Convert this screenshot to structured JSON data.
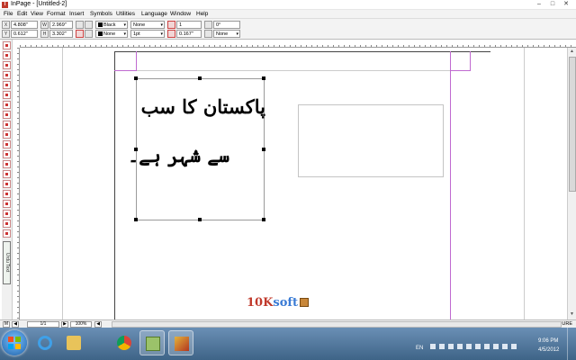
{
  "window": {
    "title": "InPage - [Untitled-2]",
    "app_icon": "I"
  },
  "window_controls": {
    "minimize": "–",
    "maximize": "□",
    "close": "✕"
  },
  "menu": [
    "File",
    "Edit",
    "View",
    "Format",
    "Insert",
    "Symbols",
    "Utilities",
    "Language",
    "Window",
    "Help"
  ],
  "toolbar": {
    "x_value": "4.808\"",
    "y_value": "0.612\"",
    "w_value": "2.969\"",
    "h_value": "3.302\"",
    "color_value": "Black",
    "fill_value": "None",
    "line_style": "None",
    "line_width": "1pt",
    "columns": "1",
    "gutter": "0.167\"",
    "angle": "0°",
    "wrap": "None"
  },
  "document": {
    "urdu_line_1": "پاکستان کا سب",
    "urdu_line_2": "سے شہر ہے۔"
  },
  "toolbox": {
    "vertical_label": "Urdu Text"
  },
  "watermark": {
    "number": "10K",
    "word": "soft"
  },
  "statusbar": {
    "page": "1/1",
    "zoom": "100%",
    "language": "URE"
  },
  "taskbar": {
    "lang": "EN",
    "time": "9:06 PM",
    "date": "4/5/2012",
    "apps": [
      "internet-explorer",
      "file-explorer",
      "chrome",
      "file-manager",
      "inpage"
    ]
  }
}
